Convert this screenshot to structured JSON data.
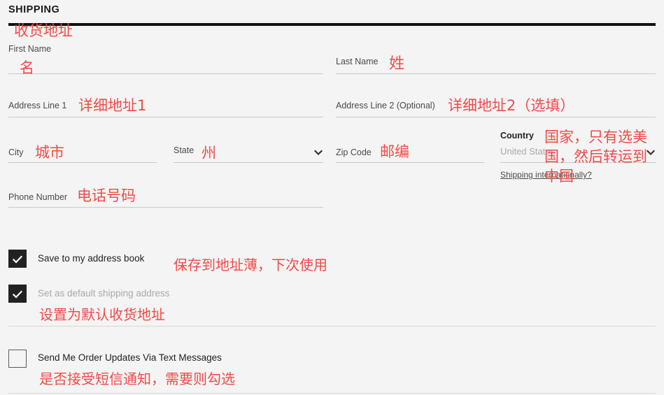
{
  "section": {
    "title": "SHIPPING"
  },
  "form": {
    "fields": [
      {
        "label": "First Name",
        "value": "",
        "placeholder": ""
      },
      {
        "label": "Last Name",
        "value": "",
        "placeholder": ""
      },
      {
        "label": "Address Line 1",
        "value": "",
        "placeholder": ""
      },
      {
        "label": "Address Line 2 (Optional)",
        "value": "",
        "placeholder": ""
      },
      {
        "label": "City",
        "value": "",
        "placeholder": ""
      },
      {
        "label": "State",
        "value": "",
        "placeholder": "",
        "control": "select"
      },
      {
        "label": "Zip Code",
        "value": "",
        "placeholder": ""
      },
      {
        "label": "Country",
        "value": "United States",
        "placeholder": "United States",
        "control": "select"
      },
      {
        "label": "Phone Number",
        "value": "",
        "placeholder": ""
      }
    ],
    "country_link": "Shipping internationally?"
  },
  "options": [
    {
      "label": "Save to my address book",
      "checked": true,
      "disabled": false
    },
    {
      "label": "Set as default shipping address",
      "checked": true,
      "disabled": true
    },
    {
      "label": "Send Me Order Updates Via Text Messages",
      "checked": false,
      "disabled": false
    }
  ],
  "annotations": [
    {
      "text": "收货地址"
    },
    {
      "text": "名"
    },
    {
      "text": "姓"
    },
    {
      "text": "详细地址1"
    },
    {
      "text": "详细地址2（选填）"
    },
    {
      "text": "城市"
    },
    {
      "text": "州"
    },
    {
      "text": "邮编"
    },
    {
      "text": "国家，只有选美"
    },
    {
      "text": "国，然后转运到"
    },
    {
      "text": "中国"
    },
    {
      "text": "电话号码"
    },
    {
      "text": "保存到地址薄，下次使用"
    },
    {
      "text": "设置为默认收货地址"
    },
    {
      "text": "是否接受短信通知，需要则勾选"
    }
  ],
  "colors": {
    "background": "#f4f4f4",
    "annotation_red": "#f04a48",
    "rule_black": "#111111",
    "checkbox_filled": "#222222",
    "underline_gray": "#c9c9c9",
    "muted_text": "#a8a8a8"
  }
}
